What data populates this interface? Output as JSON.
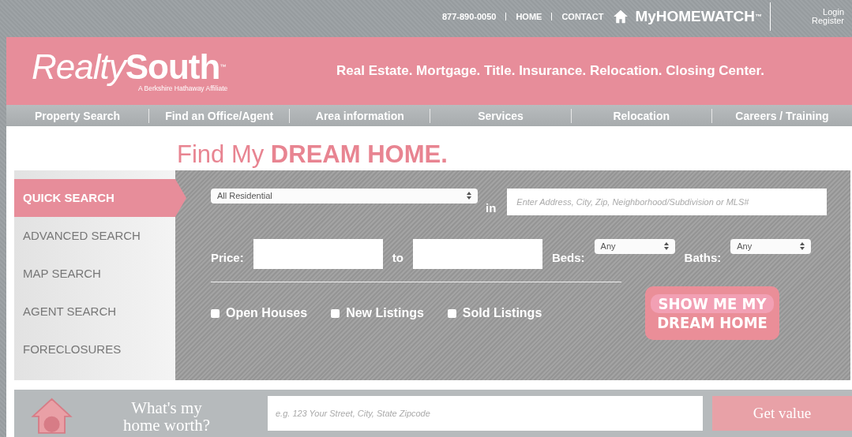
{
  "top_bar": {
    "phone": "877-890-0050",
    "links": [
      "HOME",
      "CONTACT"
    ],
    "brand": "MyHOMEWATCH",
    "brand_mark": "™",
    "account_links": [
      "Login",
      "Register"
    ]
  },
  "header": {
    "logo_light": "Realty",
    "logo_bold": "South",
    "logo_mark": "™",
    "logo_tagline": "A Berkshire Hathaway Affiliate",
    "tagline": "Real Estate. Mortgage. Title. Insurance. Relocation. Closing Center."
  },
  "nav": [
    "Property Search",
    "Find an Office/Agent",
    "Area information",
    "Services",
    "Relocation",
    "Careers / Training"
  ],
  "heading": "Find My **DREAM HOME.**",
  "search_tabs": [
    {
      "label": "QUICK SEARCH",
      "selected": true
    },
    {
      "label": "ADVANCED SEARCH",
      "selected": false
    },
    {
      "label": "MAP SEARCH",
      "selected": false
    },
    {
      "label": "AGENT SEARCH",
      "selected": false
    },
    {
      "label": "FORECLOSURES",
      "selected": false
    }
  ],
  "search": {
    "type_select": "All Residential",
    "in_label": "in",
    "location_placeholder": "Enter Address, City, Zip, Neighborhood/Subdivision or MLS#",
    "price_label": "Price:",
    "to_label": "to",
    "beds_label": "Beds:",
    "beds_select": "Any",
    "baths_label": "Baths:",
    "baths_select": "Any",
    "options": [
      {
        "label": "Open Houses",
        "checked": false
      },
      {
        "label": "New Listings",
        "checked": false
      },
      {
        "label": "Sold Listings",
        "checked": false
      }
    ],
    "submit": [
      "SHOW ME MY",
      "DREAM HOME"
    ]
  },
  "home_worth": {
    "title": [
      "What's my",
      "home worth?"
    ],
    "placeholder": "e.g. 123 Your Street, City, State Zipcode",
    "button": "Get value"
  }
}
